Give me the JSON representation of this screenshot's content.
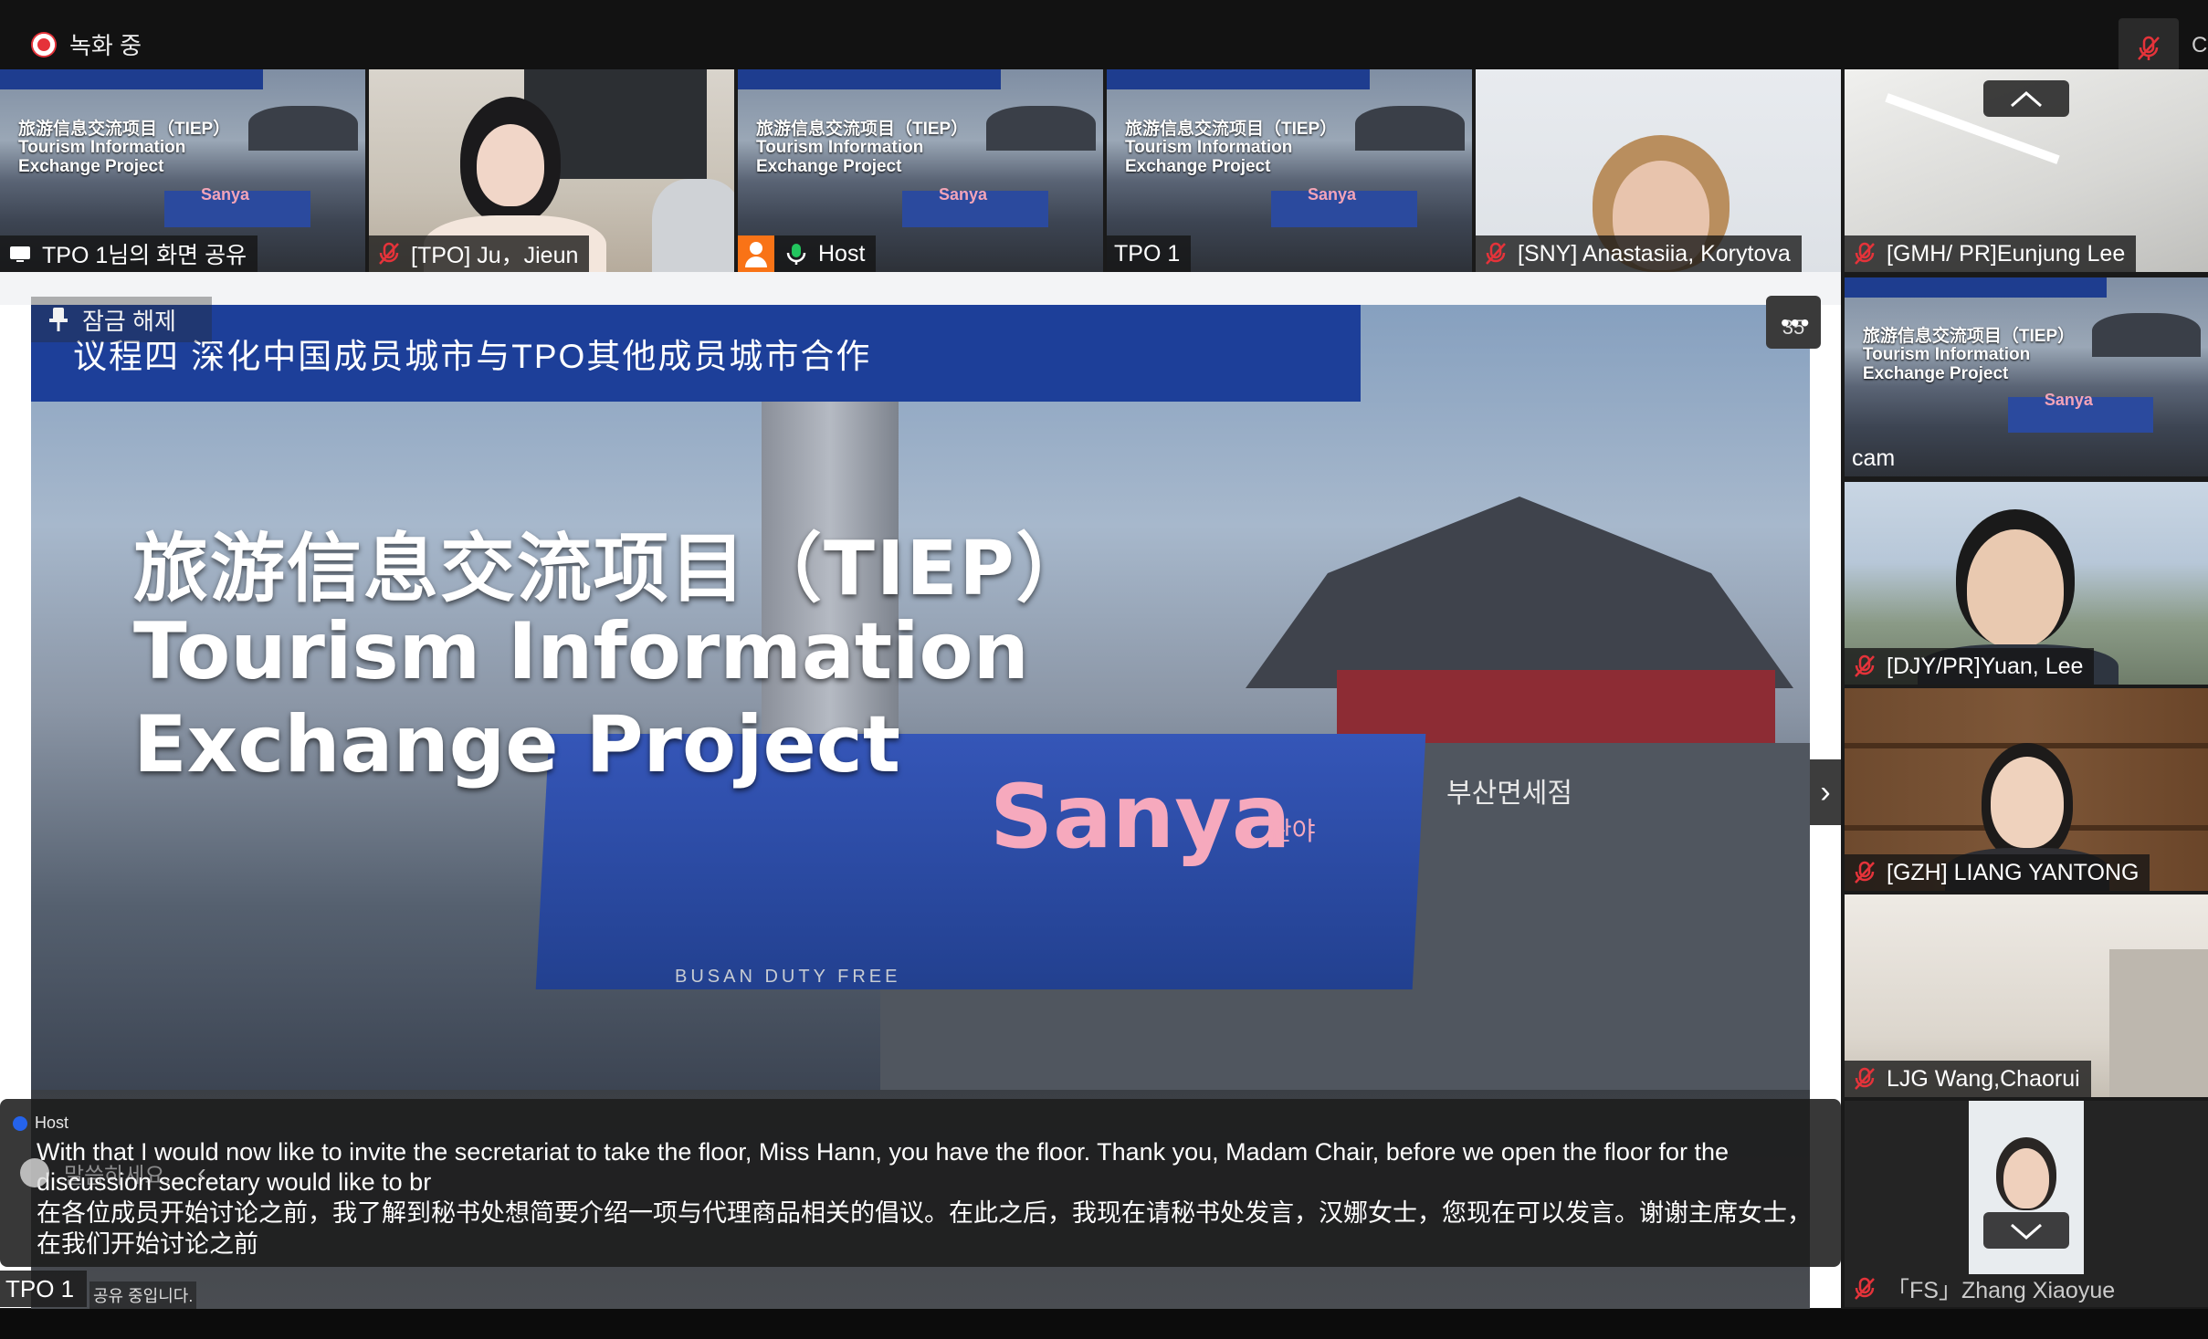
{
  "recording": {
    "label": "녹화 중"
  },
  "top_right_partial": "C",
  "thumbnails": [
    {
      "name": "TPO 1님의 화면 공유"
    },
    {
      "name": "[TPO] Ju，Jieun"
    },
    {
      "name": "Host"
    },
    {
      "name": "TPO 1"
    },
    {
      "name": "[SNY] Anastasiia, Korytova"
    },
    {
      "name": "[GMH/ PR]Eunjung Lee"
    }
  ],
  "slide_thumb": {
    "title_cn": "旅游信息交流项目（TIEP）",
    "title_en1": "Tourism Information",
    "title_en2": "Exchange Project",
    "sanya": "Sanya"
  },
  "stage": {
    "pin_label": "잠금 해제",
    "agenda": "议程四 深化中国成员城市与TPO其他成员城市合作",
    "title_cn": "旅游信息交流项目（TIEP）",
    "title_en1": "Tourism Information",
    "title_en2": "Exchange Project",
    "sanya": "Sanya",
    "sanya_ko": "싼야",
    "store_sign": "부산면세점",
    "duty_free": "BUSAN DUTY FREE",
    "page_badge": "35",
    "more": "•••",
    "next": "›"
  },
  "caption": {
    "speaker": "Host",
    "english": "With that I would now like to invite the secretariat to take the floor, Miss Hann, you have the floor. Thank you, Madam Chair, before we open the floor for the discussion secretary would like to br",
    "chinese": "在各位成员开始讨论之前，我了解到秘书处想简要介绍一项与代理商品相关的倡议。在此之后，我现在请秘书处发言，汉娜女士，您现在可以发言。谢谢主席女士，在我们开始讨论之前",
    "chat_placeholder": "말씀하세요...",
    "chat_chevron": "‹"
  },
  "bottom": {
    "presenter": "TPO 1",
    "sharing_status": "공유 중입니다."
  },
  "right_column": [
    {
      "name": "cam"
    },
    {
      "name": "[DJY/PR]Yuan, Lee"
    },
    {
      "name": "[GZH] LIANG YANTONG"
    },
    {
      "name": "LJG  Wang,Chaorui"
    },
    {
      "name": "「FS」Zhang Xiaoyue"
    }
  ],
  "colors": {
    "accent_active": "#22c55e",
    "agenda_blue": "#1d3f99",
    "recording_red": "#e5333a",
    "caption_blue": "#2563eb"
  }
}
